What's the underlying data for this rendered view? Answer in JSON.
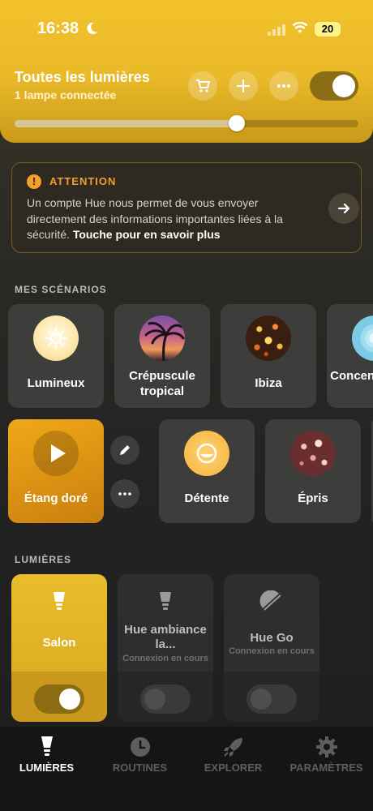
{
  "status_bar": {
    "time": "16:38",
    "battery": "20"
  },
  "header": {
    "title": "Toutes les lumières",
    "subtitle": "1 lampe connectée",
    "brightness": 0.64,
    "master_on": true
  },
  "attention": {
    "label": "ATTENTION",
    "text": "Un compte Hue nous permet de vous envoyer directement des informations importantes liées à la sécurité.",
    "link": "Touche pour en savoir plus"
  },
  "scenes": {
    "section_label": "MES SCÉNARIOS",
    "row1": [
      {
        "label": "Lumineux"
      },
      {
        "label": "Crépuscule tropical"
      },
      {
        "label": "Ibiza"
      },
      {
        "label": "Concentration"
      }
    ],
    "row2": [
      {
        "label": "Étang doré"
      },
      {
        "label": "Détente"
      },
      {
        "label": "Épris"
      }
    ]
  },
  "lights": {
    "section_label": "LUMIÈRES",
    "items": [
      {
        "name": "Salon",
        "status": "",
        "on": true
      },
      {
        "name": "Hue ambiance la...",
        "status": "Connexion en cours",
        "on": false
      },
      {
        "name": "Hue Go",
        "status": "Connexion en cours",
        "on": false
      }
    ]
  },
  "tabs": [
    {
      "label": "LUMIÈRES",
      "active": true
    },
    {
      "label": "ROUTINES",
      "active": false
    },
    {
      "label": "EXPLORER",
      "active": false
    },
    {
      "label": "PARAMÈTRES",
      "active": false
    }
  ],
  "colors": {
    "accent": "#f2c32c",
    "warning": "#f2a02a",
    "scene_active": "#e89c14"
  }
}
